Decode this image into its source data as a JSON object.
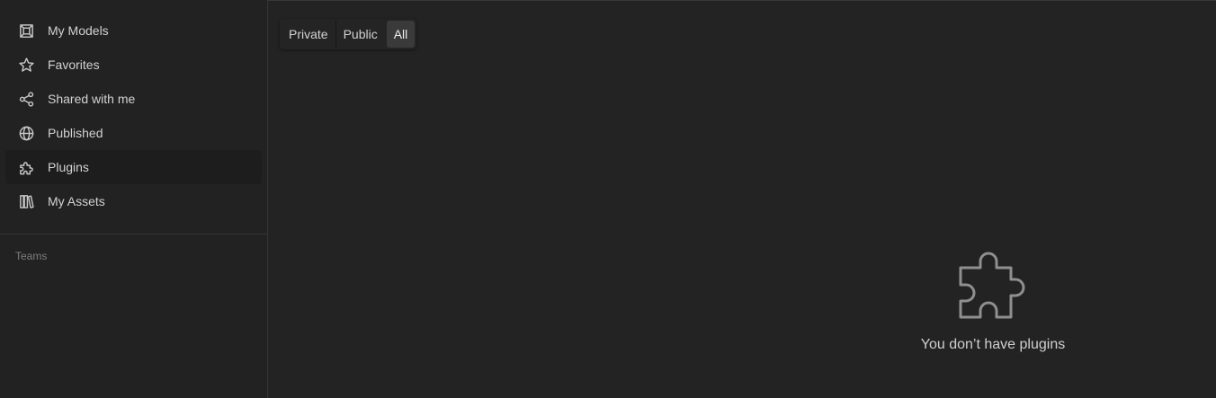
{
  "sidebar": {
    "items": [
      {
        "label": "My Models",
        "icon": "cube-box-icon",
        "active": false
      },
      {
        "label": "Favorites",
        "icon": "star-icon",
        "active": false
      },
      {
        "label": "Shared with me",
        "icon": "share-icon",
        "active": false
      },
      {
        "label": "Published",
        "icon": "globe-icon",
        "active": false
      },
      {
        "label": "Plugins",
        "icon": "puzzle-icon",
        "active": true
      },
      {
        "label": "My Assets",
        "icon": "library-icon",
        "active": false
      }
    ],
    "teams_label": "Teams"
  },
  "filter": {
    "options": [
      "Private",
      "Public",
      "All"
    ],
    "selected": "All"
  },
  "empty_state": {
    "icon": "puzzle-icon",
    "message": "You don’t have plugins"
  },
  "colors": {
    "background": "#232323",
    "sidebar_active": "#1d1d1d",
    "segment_selected": "#3a3a3a"
  }
}
